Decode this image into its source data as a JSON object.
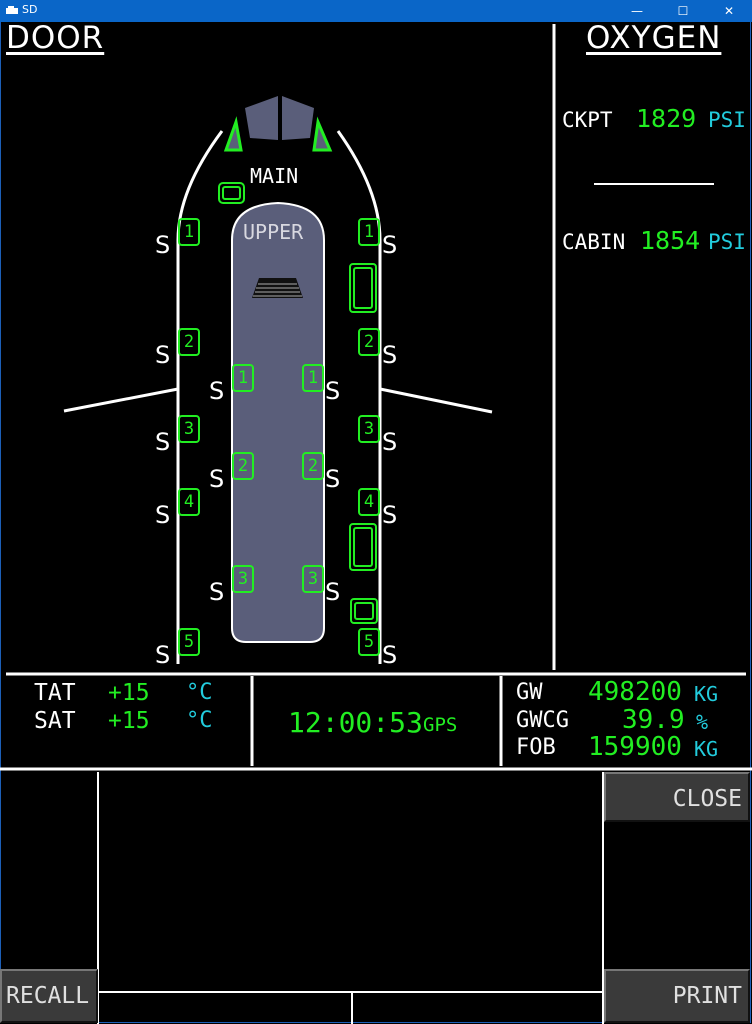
{
  "window": {
    "title": "SD",
    "minimize": "—",
    "maximize": "☐",
    "close": "✕"
  },
  "door": {
    "title": "DOOR",
    "main_label": "MAIN",
    "upper_label": "UPPER",
    "slide_letter": "S",
    "main_doors": [
      "1",
      "2",
      "3",
      "4",
      "5"
    ],
    "upper_doors": [
      "1",
      "2",
      "3"
    ]
  },
  "oxygen": {
    "title": "OXYGEN",
    "ckpt_label": "CKPT",
    "ckpt_value": "1829",
    "ckpt_unit": "PSI",
    "cabin_label": "CABIN",
    "cabin_value": "1854",
    "cabin_unit": "PSI"
  },
  "status": {
    "tat_label": "TAT",
    "tat_value": "+15",
    "tat_unit": "°C",
    "sat_label": "SAT",
    "sat_value": "+15",
    "sat_unit": "°C",
    "time": "12:00:53",
    "time_source": "GPS",
    "gw_label": "GW",
    "gw_value": "498200",
    "gw_unit": "KG",
    "gwcg_label": "GWCG",
    "gwcg_value": "39.9",
    "gwcg_unit": "%",
    "fob_label": "FOB",
    "fob_value": "159900",
    "fob_unit": "KG"
  },
  "buttons": {
    "close": "CLOSE",
    "recall": "RECALL",
    "print": "PRINT"
  },
  "colors": {
    "good": "#22ee22",
    "unit": "#22ccdd",
    "deck": "#5a5e7a",
    "text": "#ffffff"
  }
}
